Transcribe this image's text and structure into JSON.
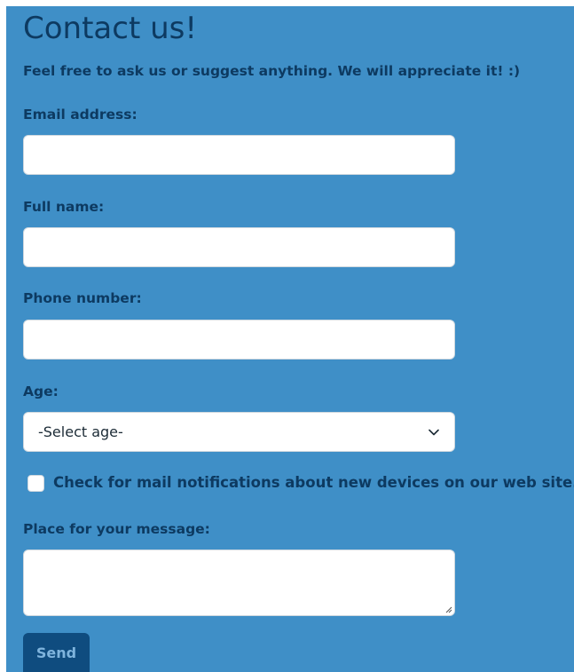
{
  "form": {
    "title": "Contact us!",
    "subtitle": "Feel free to ask us or suggest anything. We will appreciate it! :)",
    "email": {
      "label": "Email address:",
      "value": ""
    },
    "full_name": {
      "label": "Full name:",
      "value": ""
    },
    "phone": {
      "label": "Phone number:",
      "value": ""
    },
    "age": {
      "label": "Age:",
      "selected": "-Select age-",
      "icon": "chevron-down-icon"
    },
    "notifications": {
      "label": "Check for mail notifications about new devices on our web site.",
      "checked": false
    },
    "message": {
      "label": "Place for your message:",
      "value": ""
    },
    "send_label": "Send"
  },
  "colors": {
    "background": "#3f8fc7",
    "text": "#0d3a61",
    "button": "#0f4c7f",
    "button_text": "#7fb4dd"
  }
}
